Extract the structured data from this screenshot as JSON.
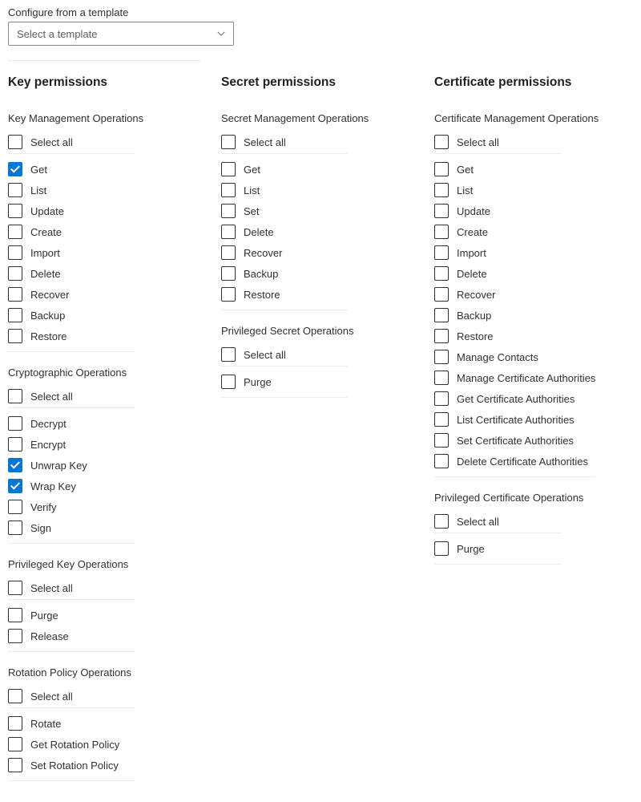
{
  "template": {
    "label": "Configure from a template",
    "placeholder": "Select a template"
  },
  "columns": [
    {
      "heading": "Key permissions",
      "groups": [
        {
          "title": "Key Management Operations",
          "select_all": "Select all",
          "options": [
            {
              "label": "Get",
              "checked": true
            },
            {
              "label": "List",
              "checked": false
            },
            {
              "label": "Update",
              "checked": false
            },
            {
              "label": "Create",
              "checked": false
            },
            {
              "label": "Import",
              "checked": false
            },
            {
              "label": "Delete",
              "checked": false
            },
            {
              "label": "Recover",
              "checked": false
            },
            {
              "label": "Backup",
              "checked": false
            },
            {
              "label": "Restore",
              "checked": false
            }
          ]
        },
        {
          "title": "Cryptographic Operations",
          "select_all": "Select all",
          "options": [
            {
              "label": "Decrypt",
              "checked": false
            },
            {
              "label": "Encrypt",
              "checked": false
            },
            {
              "label": "Unwrap Key",
              "checked": true
            },
            {
              "label": "Wrap Key",
              "checked": true
            },
            {
              "label": "Verify",
              "checked": false
            },
            {
              "label": "Sign",
              "checked": false
            }
          ]
        },
        {
          "title": "Privileged Key Operations",
          "select_all": "Select all",
          "options": [
            {
              "label": "Purge",
              "checked": false
            },
            {
              "label": "Release",
              "checked": false
            }
          ]
        },
        {
          "title": "Rotation Policy Operations",
          "select_all": "Select all",
          "options": [
            {
              "label": "Rotate",
              "checked": false
            },
            {
              "label": "Get Rotation Policy",
              "checked": false
            },
            {
              "label": "Set Rotation Policy",
              "checked": false
            }
          ]
        }
      ]
    },
    {
      "heading": "Secret permissions",
      "groups": [
        {
          "title": "Secret Management Operations",
          "select_all": "Select all",
          "options": [
            {
              "label": "Get",
              "checked": false
            },
            {
              "label": "List",
              "checked": false
            },
            {
              "label": "Set",
              "checked": false
            },
            {
              "label": "Delete",
              "checked": false
            },
            {
              "label": "Recover",
              "checked": false
            },
            {
              "label": "Backup",
              "checked": false
            },
            {
              "label": "Restore",
              "checked": false
            }
          ]
        },
        {
          "title": "Privileged Secret Operations",
          "select_all": "Select all",
          "options": [
            {
              "label": "Purge",
              "checked": false
            }
          ]
        }
      ]
    },
    {
      "heading": "Certificate permissions",
      "groups": [
        {
          "title": "Certificate Management Operations",
          "select_all": "Select all",
          "options": [
            {
              "label": "Get",
              "checked": false
            },
            {
              "label": "List",
              "checked": false
            },
            {
              "label": "Update",
              "checked": false
            },
            {
              "label": "Create",
              "checked": false
            },
            {
              "label": "Import",
              "checked": false
            },
            {
              "label": "Delete",
              "checked": false
            },
            {
              "label": "Recover",
              "checked": false
            },
            {
              "label": "Backup",
              "checked": false
            },
            {
              "label": "Restore",
              "checked": false
            },
            {
              "label": "Manage Contacts",
              "checked": false
            },
            {
              "label": "Manage Certificate Authorities",
              "checked": false
            },
            {
              "label": "Get Certificate Authorities",
              "checked": false
            },
            {
              "label": "List Certificate Authorities",
              "checked": false
            },
            {
              "label": "Set Certificate Authorities",
              "checked": false
            },
            {
              "label": "Delete Certificate Authorities",
              "checked": false
            }
          ]
        },
        {
          "title": "Privileged Certificate Operations",
          "select_all": "Select all",
          "options": [
            {
              "label": "Purge",
              "checked": false
            }
          ]
        }
      ]
    }
  ]
}
